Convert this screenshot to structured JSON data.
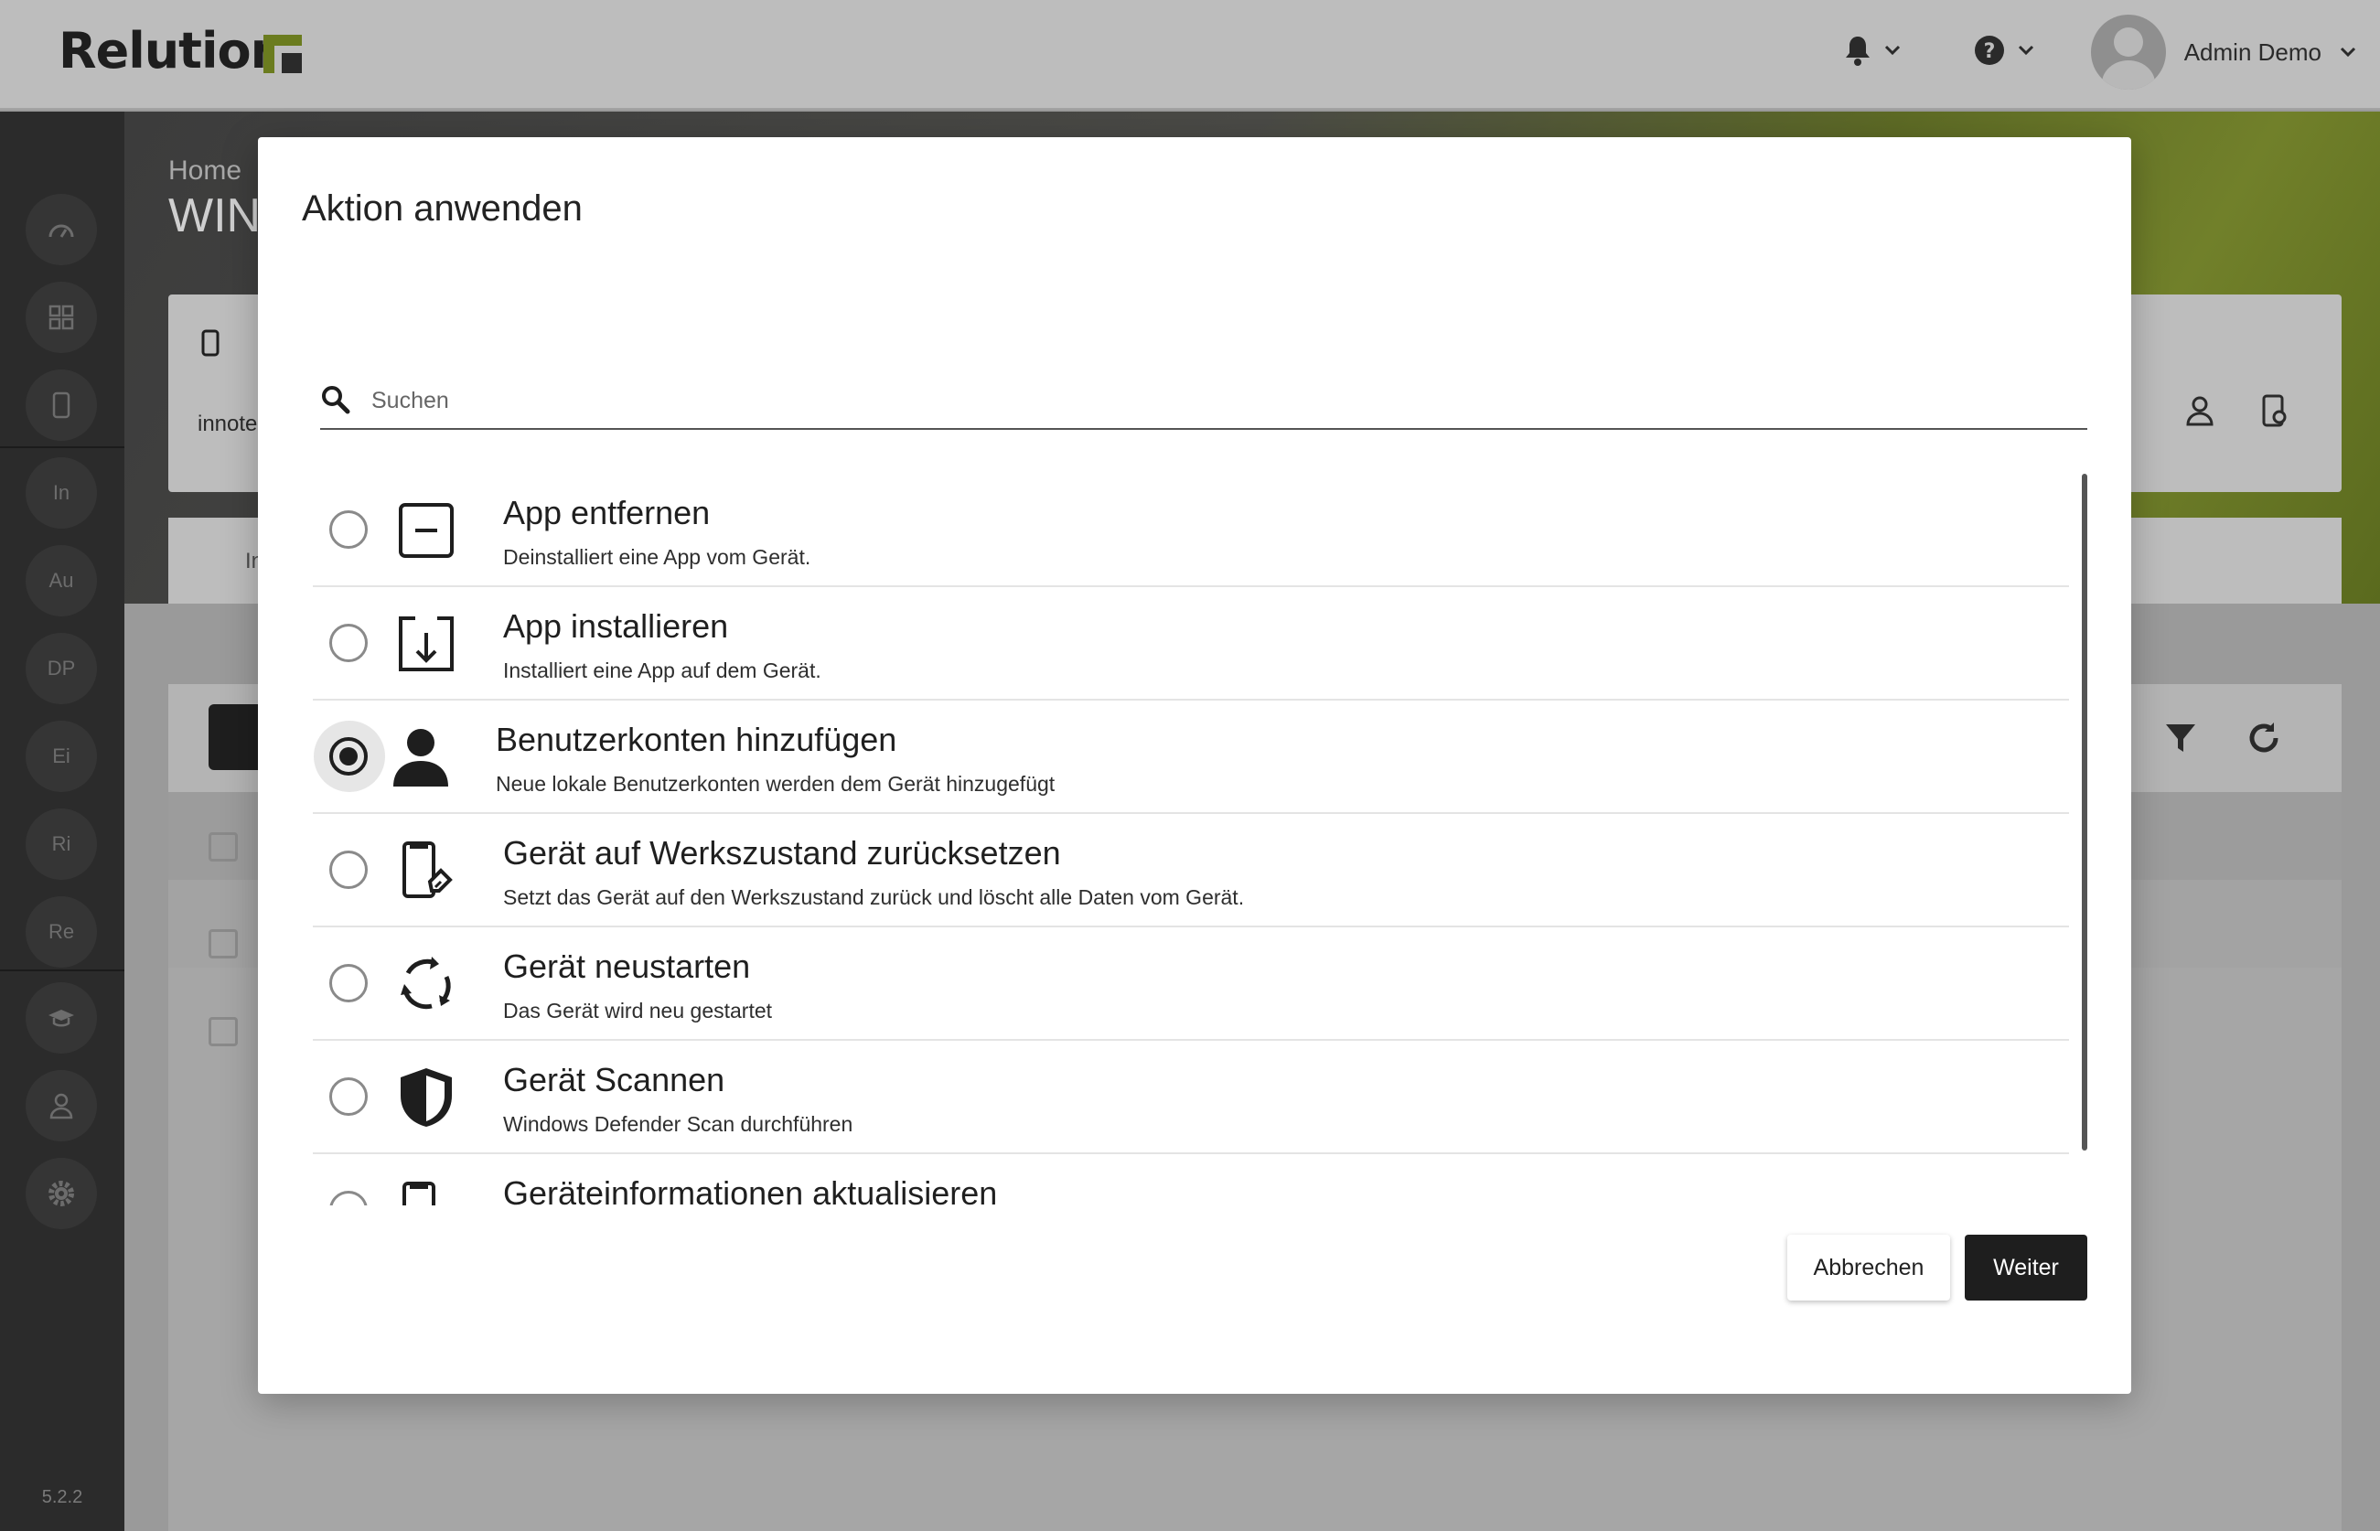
{
  "app": {
    "logo_text": "Relution",
    "version": "5.2.2",
    "user_name": "Admin Demo"
  },
  "sidebar": {
    "items": [
      "In",
      "Au",
      "DP",
      "Ei",
      "Ri",
      "Re"
    ]
  },
  "background": {
    "breadcrumb": "Home",
    "page_title_visible": "WIN",
    "card_text_visible": "innote",
    "card_tab_visible": "In"
  },
  "dialog": {
    "title": "Aktion anwenden",
    "search_placeholder": "Suchen",
    "actions": [
      {
        "title": "App entfernen",
        "description": "Deinstalliert eine App vom Gerät.",
        "icon": "app-remove-icon",
        "selected": false
      },
      {
        "title": "App installieren",
        "description": "Installiert eine App auf dem Gerät.",
        "icon": "app-install-icon",
        "selected": false
      },
      {
        "title": "Benutzerkonten hinzufügen",
        "description": "Neue lokale Benutzerkonten werden dem Gerät hinzugefügt",
        "icon": "user-icon",
        "selected": true
      },
      {
        "title": "Gerät auf Werkszustand zurücksetzen",
        "description": "Setzt das Gerät auf den Werkszustand zurück und löscht alle Daten vom Gerät.",
        "icon": "device-wipe-icon",
        "selected": false
      },
      {
        "title": "Gerät neustarten",
        "description": "Das Gerät wird neu gestartet",
        "icon": "restart-icon",
        "selected": false
      },
      {
        "title": "Gerät Scannen",
        "description": "Windows Defender Scan durchführen",
        "icon": "shield-icon",
        "selected": false
      },
      {
        "title": "Geräteinformationen aktualisieren",
        "description": "",
        "icon": "device-info-icon",
        "selected": false
      }
    ],
    "cancel_label": "Abbrechen",
    "next_label": "Weiter"
  },
  "colors": {
    "accent": "#1e1e1e",
    "brand_green": "#6b7c1f"
  }
}
